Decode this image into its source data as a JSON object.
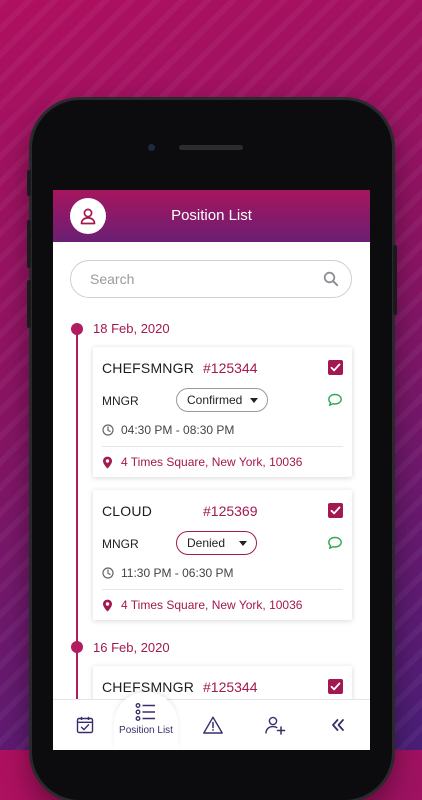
{
  "header": {
    "title": "Position List"
  },
  "search": {
    "placeholder": "Search"
  },
  "groups": [
    {
      "date": "18 Feb, 2020",
      "cards": [
        {
          "title": "CHEFSMNGR",
          "id": "#125344",
          "role": "MNGR",
          "status": "Confirmed",
          "time": "04:30 PM - 08:30 PM",
          "location": "4 Times Square, New York, 10036"
        },
        {
          "title": "CLOUD",
          "id": "#125369",
          "role": "MNGR",
          "status": "Denied",
          "time": "11:30 PM - 06:30 PM",
          "location": "4 Times Square, New York, 10036"
        }
      ]
    },
    {
      "date": "16 Feb, 2020",
      "cards": [
        {
          "title": "CHEFSMNGR",
          "id": "#125344"
        }
      ]
    }
  ],
  "nav": {
    "items": [
      {
        "icon": "calendar-check-icon"
      },
      {
        "icon": "list-icon",
        "label": "Position List"
      },
      {
        "icon": "warning-icon"
      },
      {
        "icon": "add-user-icon"
      },
      {
        "icon": "double-chevron-left-icon"
      }
    ]
  },
  "colors": {
    "accent": "#a3184f",
    "header_top": "#a7155e",
    "header_bottom": "#6a1f74",
    "chat_icon": "#2fa84f"
  }
}
